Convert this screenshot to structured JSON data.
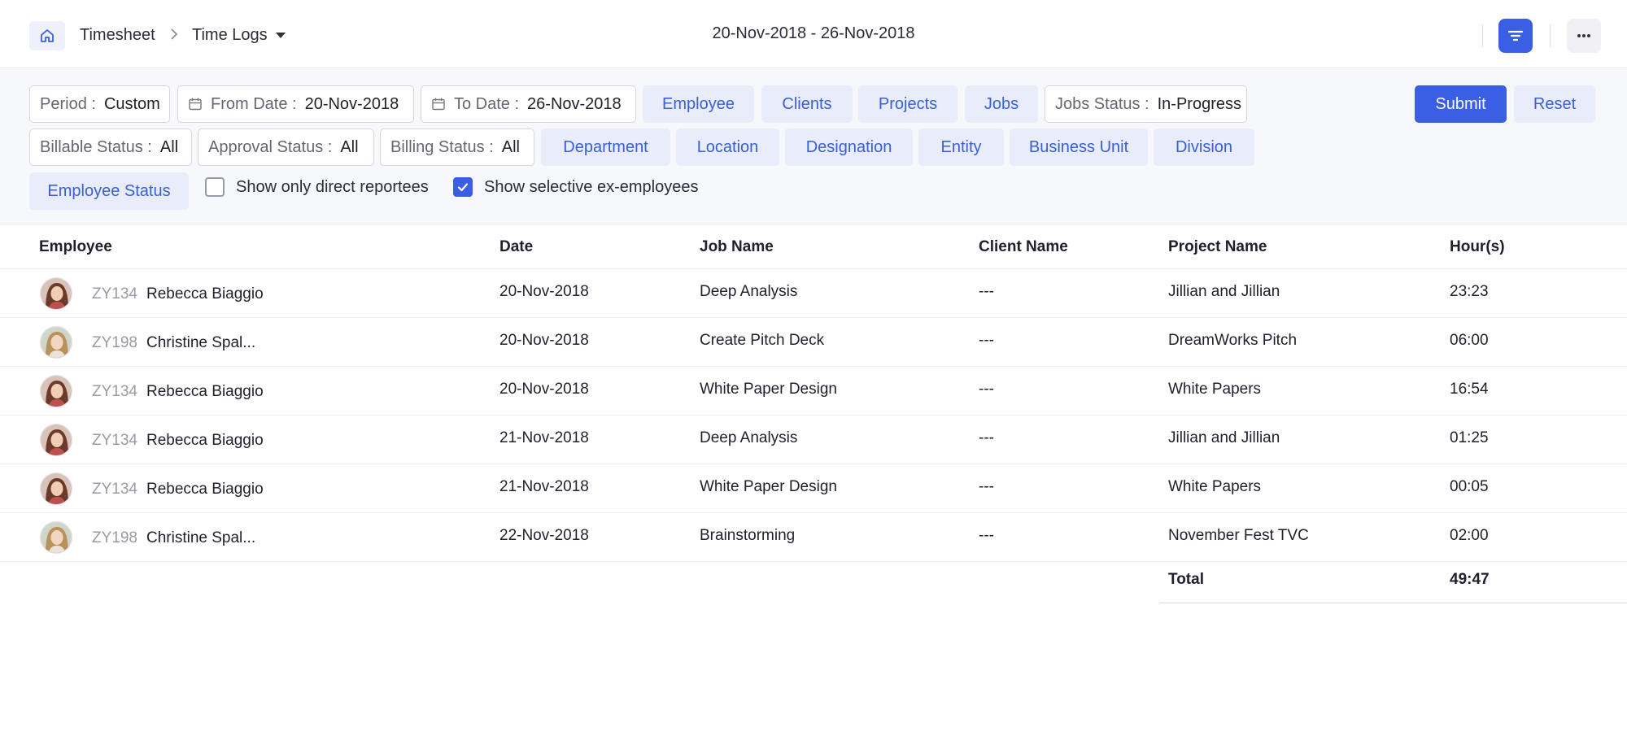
{
  "header": {
    "breadcrumb_root": "Timesheet",
    "breadcrumb_current": "Time Logs",
    "date_range": "20-Nov-2018 - 26-Nov-2018"
  },
  "filters": {
    "period_label": "Period :",
    "period_value": "Custom",
    "from_label": "From Date :",
    "from_value": "20-Nov-2018",
    "to_label": "To Date :",
    "to_value": "26-Nov-2018",
    "jobs_status_label": "Jobs Status :",
    "jobs_status_value": "In-Progress",
    "billable_label": "Billable Status :",
    "billable_value": "All",
    "approval_label": "Approval Status :",
    "approval_value": "All",
    "billing_label": "Billing Status :",
    "billing_value": "All",
    "chips": {
      "employee": "Employee",
      "clients": "Clients",
      "projects": "Projects",
      "jobs": "Jobs",
      "department": "Department",
      "location": "Location",
      "designation": "Designation",
      "entity": "Entity",
      "business_unit": "Business Unit",
      "division": "Division",
      "employee_status": "Employee Status"
    },
    "submit_label": "Submit",
    "reset_label": "Reset",
    "direct_reportees_label": "Show only direct reportees",
    "direct_reportees_checked": false,
    "ex_employees_label": "Show selective ex-employees",
    "ex_employees_checked": true
  },
  "table": {
    "columns": [
      "Employee",
      "Date",
      "Job Name",
      "Client Name",
      "Project Name",
      "Hour(s)"
    ],
    "rows": [
      {
        "id": "ZY134",
        "name": "Rebecca Biaggio",
        "date": "20-Nov-2018",
        "job": "Deep Analysis",
        "client": "---",
        "project": "Jillian and Jillian",
        "hours": "23:23"
      },
      {
        "id": "ZY198",
        "name": "Christine Spal...",
        "date": "20-Nov-2018",
        "job": "Create Pitch Deck",
        "client": "---",
        "project": "DreamWorks Pitch",
        "hours": "06:00"
      },
      {
        "id": "ZY134",
        "name": "Rebecca Biaggio",
        "date": "20-Nov-2018",
        "job": "White Paper Design",
        "client": "---",
        "project": "White Papers",
        "hours": "16:54"
      },
      {
        "id": "ZY134",
        "name": "Rebecca Biaggio",
        "date": "21-Nov-2018",
        "job": "Deep Analysis",
        "client": "---",
        "project": "Jillian and Jillian",
        "hours": "01:25"
      },
      {
        "id": "ZY134",
        "name": "Rebecca Biaggio",
        "date": "21-Nov-2018",
        "job": "White Paper Design",
        "client": "---",
        "project": "White Papers",
        "hours": "00:05"
      },
      {
        "id": "ZY198",
        "name": "Christine Spal...",
        "date": "22-Nov-2018",
        "job": "Brainstorming",
        "client": "---",
        "project": "November Fest TVC",
        "hours": "02:00"
      }
    ],
    "total_label": "Total",
    "total_value": "49:47"
  },
  "colors": {
    "accent": "#3a5fe5",
    "chip_bg": "#e8ecfb",
    "chip_text": "#3a5fd6"
  }
}
